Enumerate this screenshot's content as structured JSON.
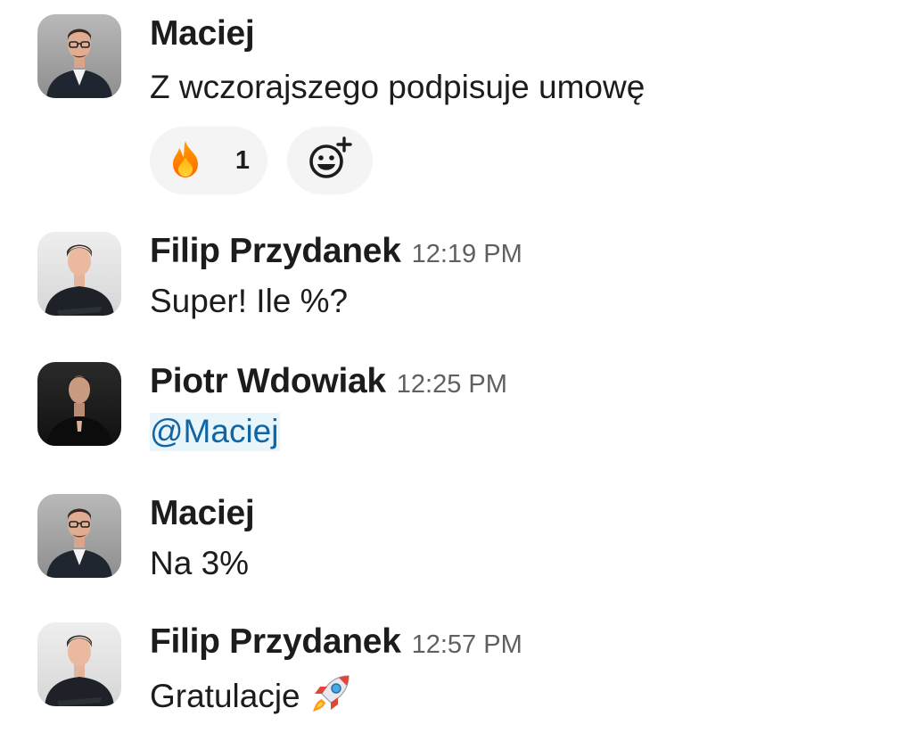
{
  "messages": [
    {
      "author": "Maciej",
      "time": "",
      "text": "Z wczorajszego podpisuje umowę",
      "avatar": "avatar-maciej",
      "reactions": [
        {
          "emoji": "fire-emoji",
          "count": "1"
        }
      ],
      "add_reaction_icon": "add-reaction-icon"
    },
    {
      "author": "Filip Przydanek",
      "time": "12:19 PM",
      "text": "Super! Ile %?",
      "avatar": "avatar-filip"
    },
    {
      "author": "Piotr Wdowiak",
      "time": "12:25 PM",
      "text": "@Maciej",
      "avatar": "avatar-piotr"
    },
    {
      "author": "Maciej",
      "time": "",
      "text": "Na 3%",
      "avatar": "avatar-maciej"
    },
    {
      "author": "Filip Przydanek",
      "time": "12:57 PM",
      "text": "Gratulacje",
      "trailing_emoji": "rocket-emoji",
      "avatar": "avatar-filip"
    }
  ],
  "colors": {
    "author": "#1d1c1d",
    "timestamp": "#616061",
    "mention_text": "#1264a3",
    "mention_bg": "#e8f5fa",
    "reaction_bg": "#f4f4f4"
  }
}
